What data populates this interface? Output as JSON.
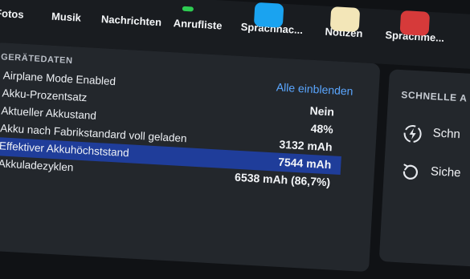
{
  "apps": [
    {
      "label": "Fotos",
      "icon": "photos-icon"
    },
    {
      "label": "Musik",
      "icon": "music-icon"
    },
    {
      "label": "Nachrichten",
      "icon": "messages-icon"
    },
    {
      "label": "Anrufliste",
      "icon": "phone-icon"
    },
    {
      "label": "Sprachnac...",
      "icon": "voicemail-icon",
      "color": "#1aa3f0"
    },
    {
      "label": "Notizen",
      "icon": "notes-icon",
      "color": "#f3e6b8"
    },
    {
      "label": "Sprachme...",
      "icon": "voice-memos-icon",
      "color": "#d63a3a"
    }
  ],
  "device_data": {
    "title": "GERÄTEDATEN",
    "show_all": "Alle einblenden",
    "rows": [
      {
        "label": "Airplane Mode Enabled",
        "value": ""
      },
      {
        "label": "Akku-Prozentsatz",
        "value": "Nein"
      },
      {
        "label": "Aktueller Akkustand",
        "value": "48%"
      },
      {
        "label": "Akku nach Fabrikstandard voll geladen",
        "value": "3132 mAh"
      },
      {
        "label": "Effektiver Akkuhöchststand",
        "value": "7544 mAh",
        "selected": true
      },
      {
        "label": "Akkuladezyklen",
        "value": "6538 mAh (86,7%)"
      }
    ]
  },
  "quick_actions": {
    "title": "SCHNELLE A",
    "items": [
      {
        "label": "Schn",
        "icon": "fast-charge-icon"
      },
      {
        "label": "Siche",
        "icon": "backup-icon"
      }
    ]
  },
  "colors": {
    "accent": "#5aa6ff",
    "selection": "#1f3d9a",
    "panel": "#23272c"
  }
}
